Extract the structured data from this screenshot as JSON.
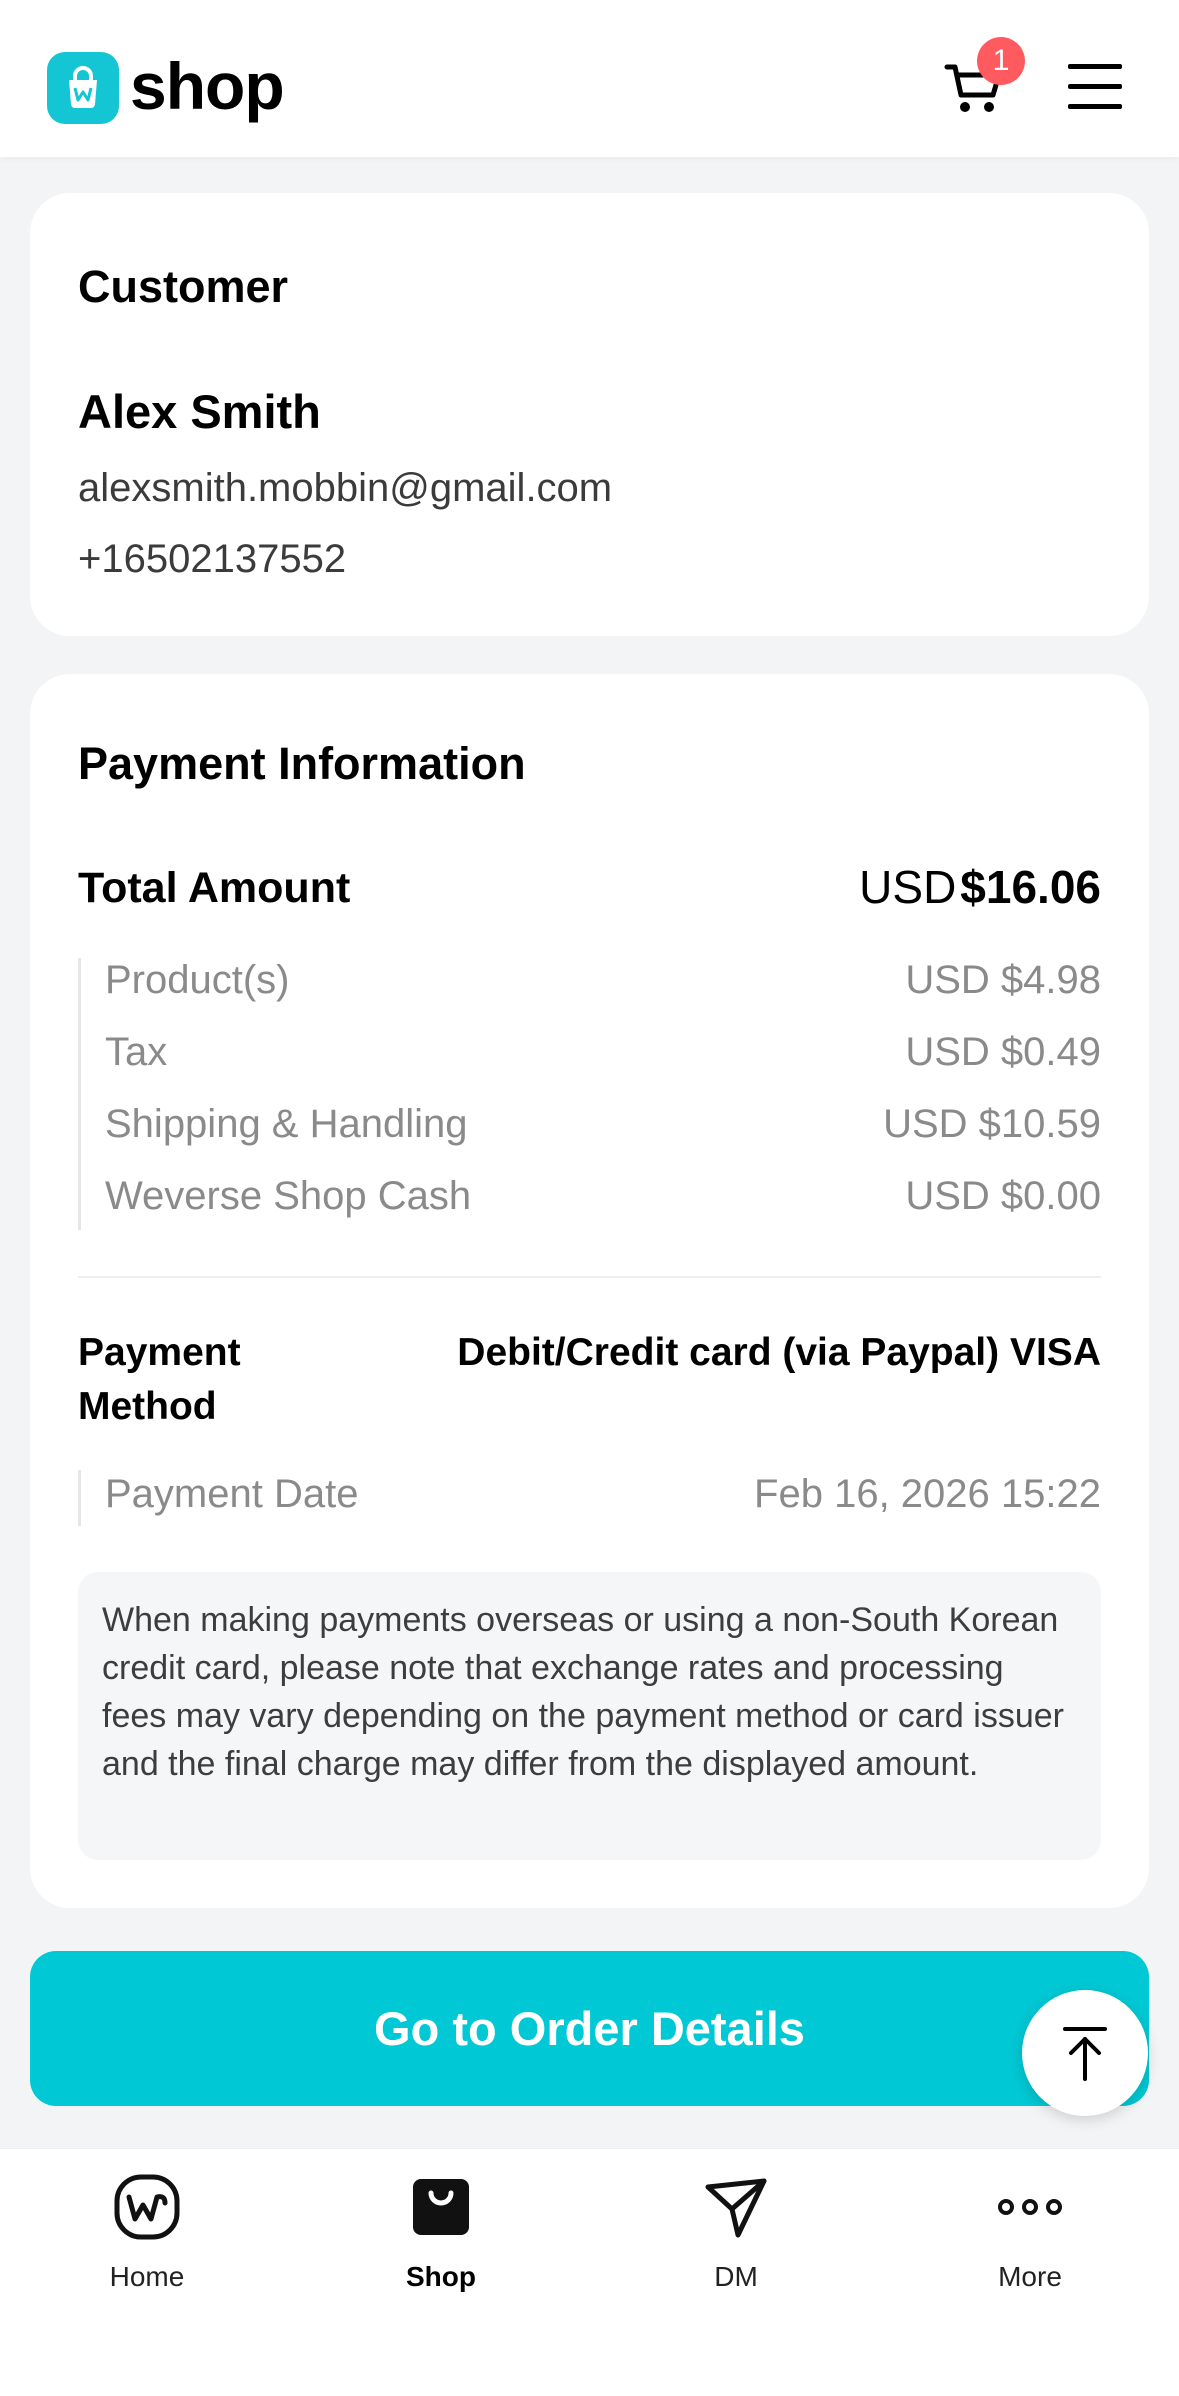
{
  "header": {
    "app_name": "shop",
    "cart_count": "1",
    "icons": [
      "weverse-shop-logo-icon",
      "cart-icon",
      "hamburger-menu-icon"
    ]
  },
  "customer": {
    "title": "Customer",
    "name": "Alex Smith",
    "email": "alexsmith.mobbin@gmail.com",
    "phone": "+16502137552"
  },
  "payment": {
    "title": "Payment Information",
    "total_label": "Total Amount",
    "total_currency": "USD",
    "total_amount": "$16.06",
    "breakdown": [
      {
        "label": "Product(s)",
        "value": "USD $4.98"
      },
      {
        "label": "Tax",
        "value": "USD $0.49"
      },
      {
        "label": "Shipping & Handling",
        "value": "USD $10.59"
      },
      {
        "label": "Weverse Shop Cash",
        "value": "USD $0.00"
      }
    ],
    "method_label": "Payment Method",
    "method_value": "Debit/Credit card (via Paypal) VISA",
    "date_label": "Payment Date",
    "date_value": "Feb 16, 2026 15:22",
    "notice": "When making payments overseas or using a non-South Korean credit card, please note that exchange rates and processing fees may vary depending on the payment method or card issuer and the final charge may differ from the displayed amount."
  },
  "cta": {
    "label": "Go to Order Details"
  },
  "nav": {
    "items": [
      {
        "label": "Home",
        "icon": "weverse-home-icon"
      },
      {
        "label": "Shop",
        "icon": "shopping-bag-icon",
        "active": true
      },
      {
        "label": "DM",
        "icon": "paper-plane-icon"
      },
      {
        "label": "More",
        "icon": "more-dots-icon"
      }
    ]
  },
  "colors": {
    "accent": "#00c8d4",
    "badge": "#ff5a5f"
  }
}
